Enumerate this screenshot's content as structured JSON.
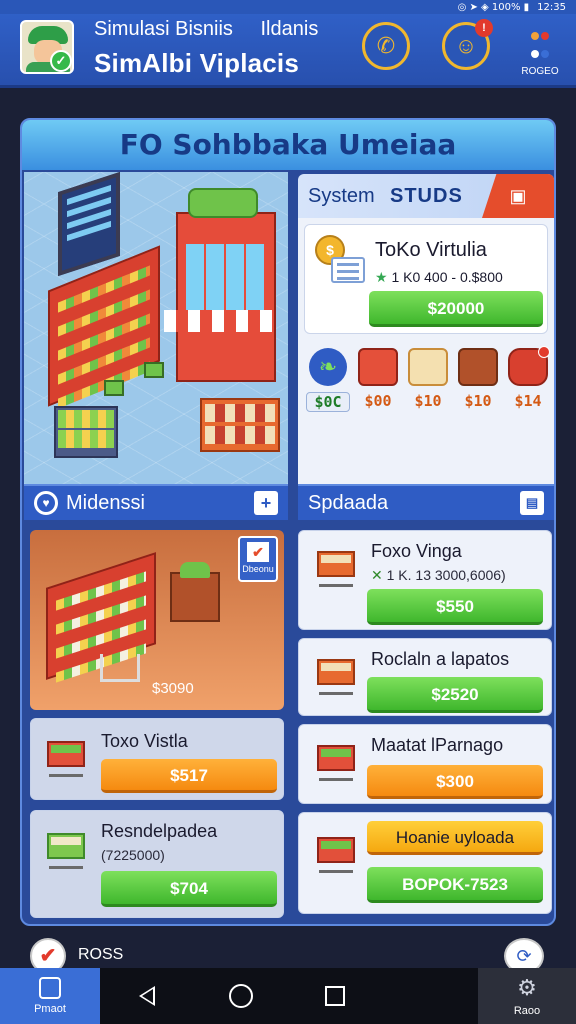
{
  "status_bar": {
    "indicators": "◎ ➤ ◈ 100% ▮",
    "time": "12:35"
  },
  "header": {
    "title_line1": "Simulasi Bisniis",
    "title_line1_extra": "Ildanis",
    "title_line2": "SimAlbi Viplacis",
    "phone_icon": "phone-icon",
    "person_icon": "person-icon",
    "notification_badge": "!",
    "menu_label": "ROGEO"
  },
  "main": {
    "title": "FO Sohbbaka Umeiaa",
    "left_section_label": "Midenssi",
    "right_section_label": "Spdaada",
    "system_panel": {
      "label_system": "System",
      "label_studs": "STUDS",
      "top_card": {
        "name": "ToKo Virtulia",
        "meta": "1 K0 400 - 0.$800",
        "button": "$20000"
      },
      "icons": [
        {
          "name": "leaf-icon",
          "price": "$0C"
        },
        {
          "name": "book-icon",
          "price": "$00"
        },
        {
          "name": "shop-icon",
          "price": "$10"
        },
        {
          "name": "plant-box-icon",
          "price": "$10"
        },
        {
          "name": "roll-icon",
          "price": "$14"
        }
      ]
    },
    "orange_scene": {
      "price": "$3090",
      "tag_label": "Dbeonu"
    },
    "left_cards": [
      {
        "title": "Toxo Vistla",
        "subtitle": "",
        "button": "$517",
        "style": "orange"
      },
      {
        "title": "Resndelpadea",
        "subtitle": "(7225000)",
        "button": "$704",
        "style": "green"
      }
    ],
    "right_cards": [
      {
        "title": "Foxo Vinga",
        "subtitle": "1 K. 13 3000,6006)",
        "button": "$550",
        "style": "green"
      },
      {
        "title": "Roclaln a lapatos",
        "subtitle": "",
        "button": "$2520",
        "style": "green"
      },
      {
        "title": "Maatat lParnago",
        "subtitle": "",
        "button": "$300",
        "style": "orange"
      },
      {
        "title": "",
        "subtitle": "",
        "button_top": "Hoanie uyloada",
        "button": "BOPOK-7523",
        "style": "green"
      }
    ]
  },
  "bottom": {
    "left_label": "ROSS"
  },
  "navbar": {
    "home_label": "Pmaot",
    "settings_label": "Raoo"
  },
  "colors": {
    "header_blue": "#2f5cc4",
    "accent_green": "#3fb72d",
    "accent_orange": "#f58a10",
    "alert_red": "#e23a2c"
  }
}
